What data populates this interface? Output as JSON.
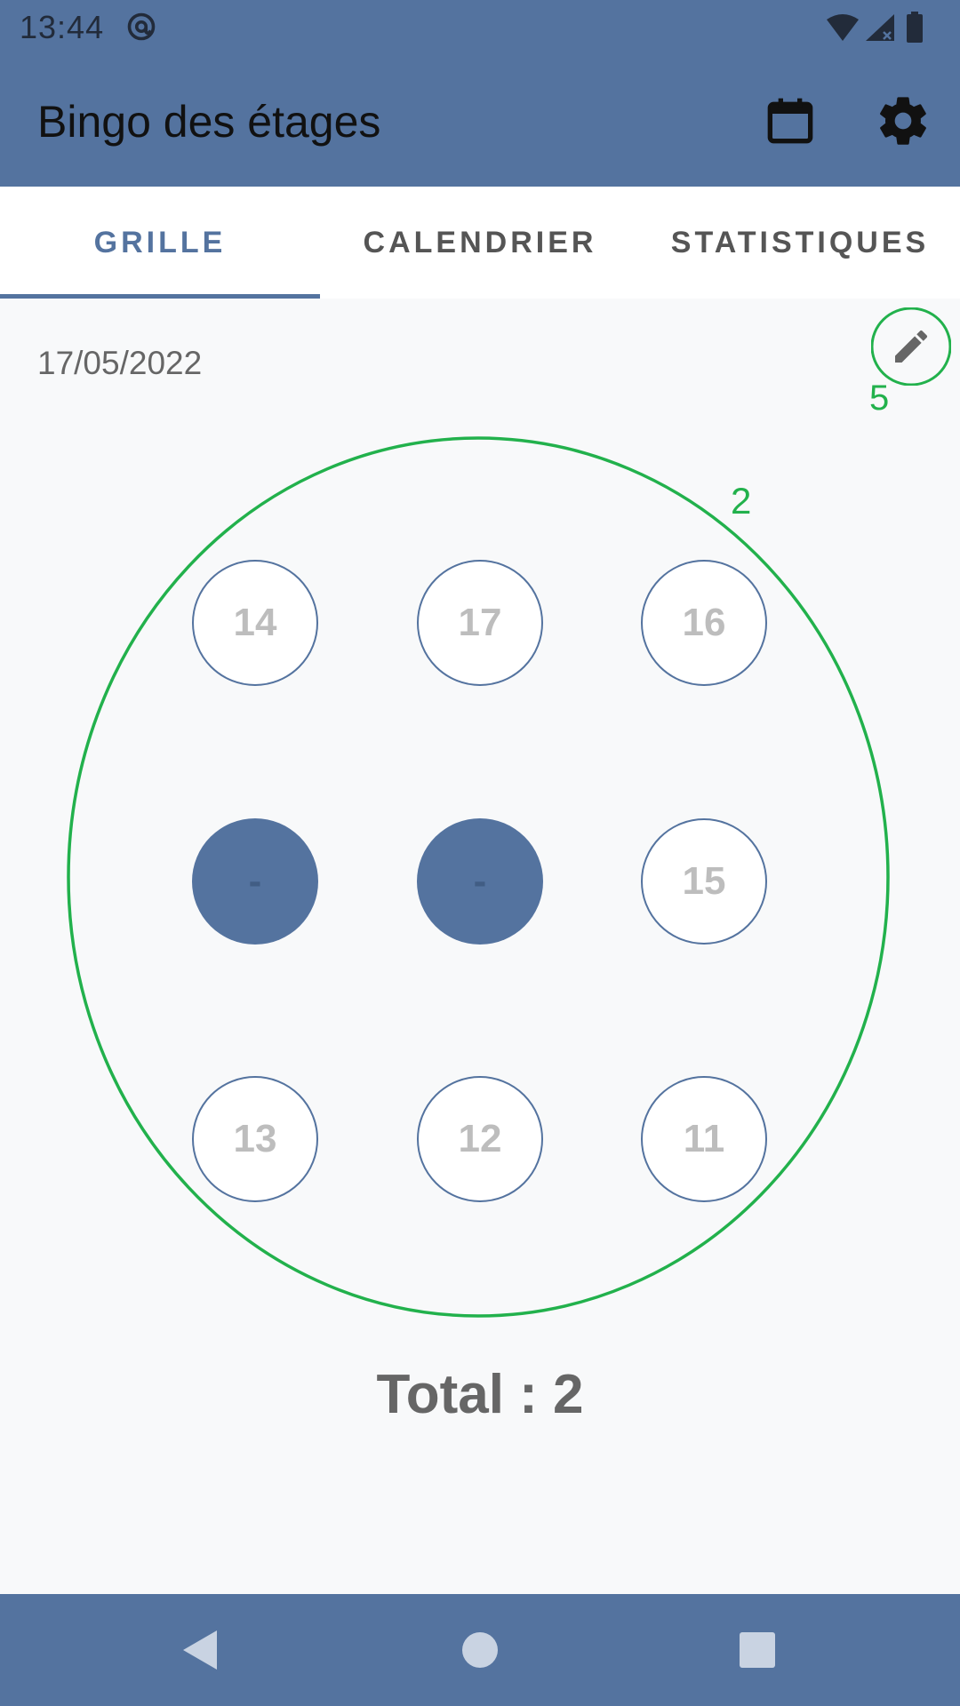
{
  "status_bar": {
    "time": "13:44"
  },
  "app_bar": {
    "title": "Bingo des étages",
    "actions": [
      "calendar-icon",
      "settings-icon"
    ]
  },
  "tabs": [
    {
      "label": "GRILLE",
      "active": true
    },
    {
      "label": "CALENDRIER",
      "active": false
    },
    {
      "label": "STATISTIQUES",
      "active": false
    }
  ],
  "grid": {
    "date": "17/05/2022",
    "edit_annotation": "5",
    "circle_annotation": "2",
    "floors": [
      "14",
      "17",
      "16",
      "-",
      "-",
      "15",
      "13",
      "12",
      "11"
    ],
    "filled": [
      false,
      false,
      false,
      true,
      true,
      false,
      false,
      false,
      false
    ],
    "total": "Total : 2"
  },
  "colors": {
    "primary": "#54739f",
    "annotation": "#22b14c",
    "floor_text": "#bdbdbd",
    "background": "#f8f9fa"
  }
}
